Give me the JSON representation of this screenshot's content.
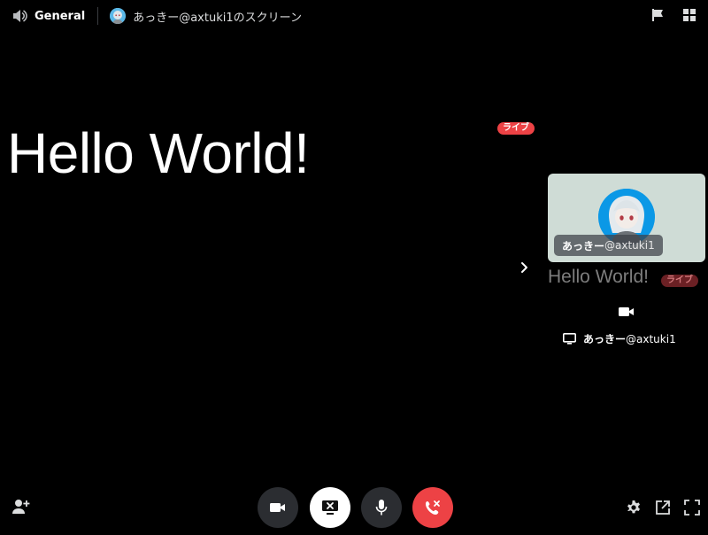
{
  "header": {
    "channel_name": "General",
    "screen_title": "あっきー@axtuki1のスクリーン"
  },
  "stage": {
    "shared_text": "Hello World!",
    "live_badge": "ライブ"
  },
  "sidebar": {
    "participant_name": "あっきー",
    "participant_handle": "@axtuki1",
    "stream_preview_text": "Hello World!",
    "live_badge": "ライブ",
    "screen_share_name": "あっきー",
    "screen_share_handle": "@axtuki1"
  },
  "controls": {
    "camera": "video-camera-icon",
    "screen": "stop-screen-share-icon",
    "mic": "microphone-icon",
    "leave": "hang-up-icon"
  },
  "colors": {
    "background": "#000000",
    "live": "#ed4245",
    "control_bg": "#2b2d31",
    "leave": "#ed4245",
    "card_bg": "#cfdcd6"
  }
}
